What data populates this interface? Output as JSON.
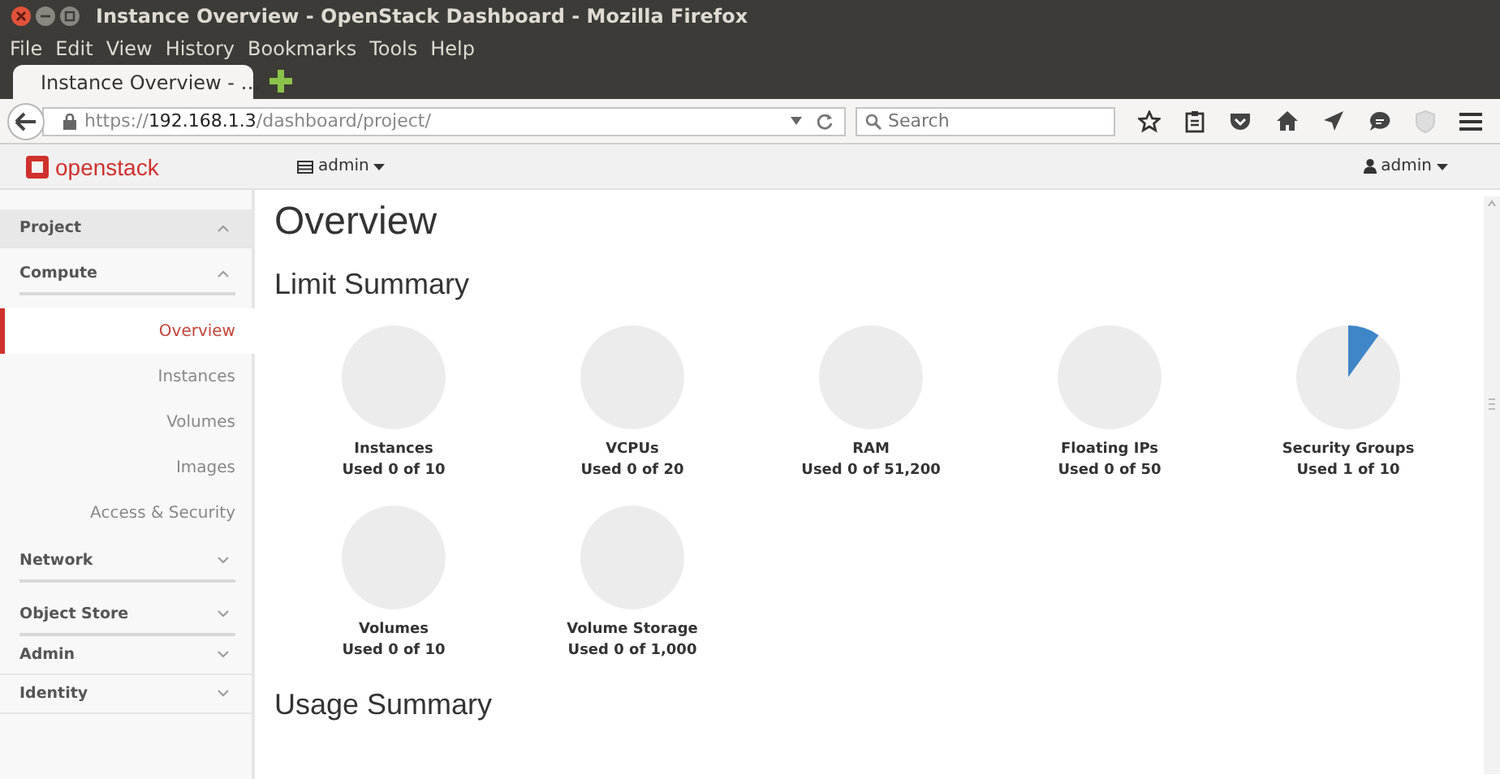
{
  "window": {
    "title": "Instance Overview - OpenStack Dashboard - Mozilla Firefox"
  },
  "menu": [
    "File",
    "Edit",
    "View",
    "History",
    "Bookmarks",
    "Tools",
    "Help"
  ],
  "tabs": [
    {
      "label": "Instance Overview - …",
      "selected": true
    }
  ],
  "address": {
    "scheme": "https://",
    "host": "192.168.1.3",
    "path": "/dashboard/project/"
  },
  "search": {
    "placeholder": "Search"
  },
  "header": {
    "logo": "openstack",
    "project": "admin",
    "user": "admin"
  },
  "sidebar": {
    "items": [
      {
        "label": "Project",
        "expanded": true,
        "children": [
          {
            "label": "Compute",
            "expanded": true,
            "children": [
              {
                "label": "Overview",
                "selected": true
              },
              {
                "label": "Instances",
                "selected": false
              },
              {
                "label": "Volumes",
                "selected": false
              },
              {
                "label": "Images",
                "selected": false
              },
              {
                "label": "Access & Security",
                "selected": false
              }
            ]
          },
          {
            "label": "Network",
            "expanded": false
          },
          {
            "label": "Object Store",
            "expanded": false
          }
        ]
      },
      {
        "label": "Admin",
        "expanded": false
      },
      {
        "label": "Identity",
        "expanded": false
      }
    ]
  },
  "page": {
    "title": "Overview",
    "limit_title": "Limit Summary",
    "usage_title": "Usage Summary"
  },
  "limits": [
    {
      "name": "Instances",
      "usage": "Used 0 of 10",
      "chart_data": {
        "type": "pie",
        "values": [
          0,
          100
        ]
      }
    },
    {
      "name": "VCPUs",
      "usage": "Used 0 of 20",
      "chart_data": {
        "type": "pie",
        "values": [
          0,
          100
        ]
      }
    },
    {
      "name": "RAM",
      "usage": "Used 0 of 51,200",
      "chart_data": {
        "type": "pie",
        "values": [
          0,
          100
        ]
      }
    },
    {
      "name": "Floating IPs",
      "usage": "Used 0 of 50",
      "chart_data": {
        "type": "pie",
        "values": [
          0,
          100
        ]
      }
    },
    {
      "name": "Security Groups",
      "usage": "Used 1 of 10",
      "chart_data": {
        "type": "pie",
        "values": [
          10,
          90
        ]
      }
    },
    {
      "name": "Volumes",
      "usage": "Used 0 of 10",
      "chart_data": {
        "type": "pie",
        "values": [
          0,
          100
        ]
      }
    },
    {
      "name": "Volume Storage",
      "usage": "Used 0 of 1,000",
      "chart_data": {
        "type": "pie",
        "values": [
          0,
          100
        ]
      }
    }
  ]
}
